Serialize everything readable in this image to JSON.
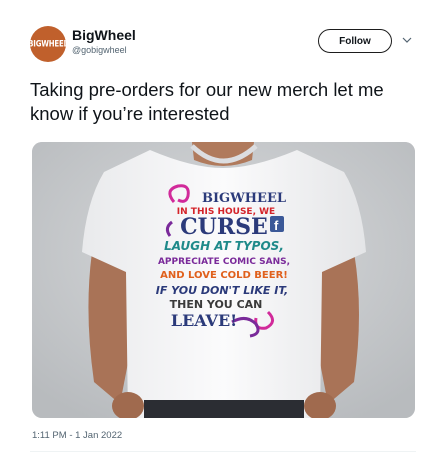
{
  "author": {
    "avatar_text": "BIGWHEEL",
    "display_name": "BigWheel",
    "handle": "@gobigwheel"
  },
  "follow_label": "Follow",
  "tweet_text": "Taking pre-orders for our new merch let me know if you’re interested",
  "shirt_print": {
    "brand": "BIGWHEEL",
    "line1": "IN THIS HOUSE, WE",
    "line2": "CURSE",
    "line3": "LAUGH AT TYPOS,",
    "line4": "APPRECIATE COMIC SANS,",
    "line5": "AND LOVE COLD BEER!",
    "line6": "IF YOU DON'T LIKE IT,",
    "line7": "THEN YOU CAN",
    "line8": "LEAVE!"
  },
  "timestamp": "1:11 PM - 1 Jan 2022",
  "colors": {
    "brand_orange": "#c0602c",
    "text_primary": "#0f1419",
    "text_secondary": "#536471",
    "print_purple": "#7a2a9a",
    "print_magenta": "#d12a9a",
    "print_navy": "#2b3a7a",
    "print_teal": "#1f8a8a",
    "print_orange": "#e0601c",
    "print_red": "#d4242a",
    "print_facebook_blue": "#3b5998"
  }
}
